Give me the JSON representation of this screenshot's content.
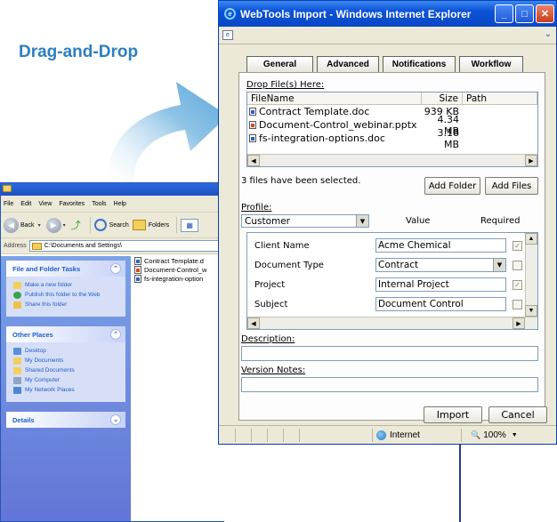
{
  "headline": "Drag-and-Drop",
  "explorer": {
    "menu": [
      "File",
      "Edit",
      "View",
      "Favorites",
      "Tools",
      "Help"
    ],
    "toolbar": {
      "back": "Back",
      "search": "Search",
      "folders": "Folders"
    },
    "address_label": "Address",
    "address_value": "C:\\Documents and Settings\\",
    "tasks": {
      "title": "File and Folder Tasks",
      "items": [
        "Make a new folder",
        "Publish this folder to the Web",
        "Share this folder"
      ]
    },
    "places": {
      "title": "Other Places",
      "items": [
        "Desktop",
        "My Documents",
        "Shared Documents",
        "My Computer",
        "My Network Places"
      ]
    },
    "details_title": "Details",
    "files": [
      "Contract Template.d",
      "Document-Control_w",
      "fs-integration-option"
    ]
  },
  "ie": {
    "title": "WebTools Import - Windows Internet Explorer",
    "tabs": [
      "General",
      "Advanced",
      "Notifications",
      "Workflow"
    ],
    "drop_label": "Drop File(s) Here:",
    "columns": [
      "FileName",
      "Size",
      "Path"
    ],
    "files": [
      {
        "name": "Contract Template.doc",
        "size": "939 KB",
        "type": "doc"
      },
      {
        "name": "Document-Control_webinar.pptx",
        "size": "4.34 MB",
        "type": "ppt"
      },
      {
        "name": "fs-integration-options.doc",
        "size": "3.18 MB",
        "type": "doc"
      }
    ],
    "selected_text": "3 files have been selected.",
    "add_folder": "Add Folder",
    "add_files": "Add Files",
    "profile_label": "Profile:",
    "profile_value": "Customer",
    "value_header": "Value",
    "required_header": "Required",
    "fields": [
      {
        "label": "Client Name",
        "value": "Acme Chemical",
        "kind": "text",
        "required": true
      },
      {
        "label": "Document Type",
        "value": "Contract",
        "kind": "select",
        "required": false
      },
      {
        "label": "Project",
        "value": "Internal Project",
        "kind": "text",
        "required": true
      },
      {
        "label": "Subject",
        "value": "Document Control",
        "kind": "text",
        "required": false
      }
    ],
    "description_label": "Description:",
    "version_label": "Version Notes:",
    "import": "Import",
    "cancel": "Cancel",
    "status_zone": "Internet",
    "zoom": "100%"
  },
  "colors": {
    "headline": "#2d7fc1",
    "arrow": "#8fc3e6",
    "titlebar": "#0a52d8",
    "connector": "#233f8d"
  }
}
